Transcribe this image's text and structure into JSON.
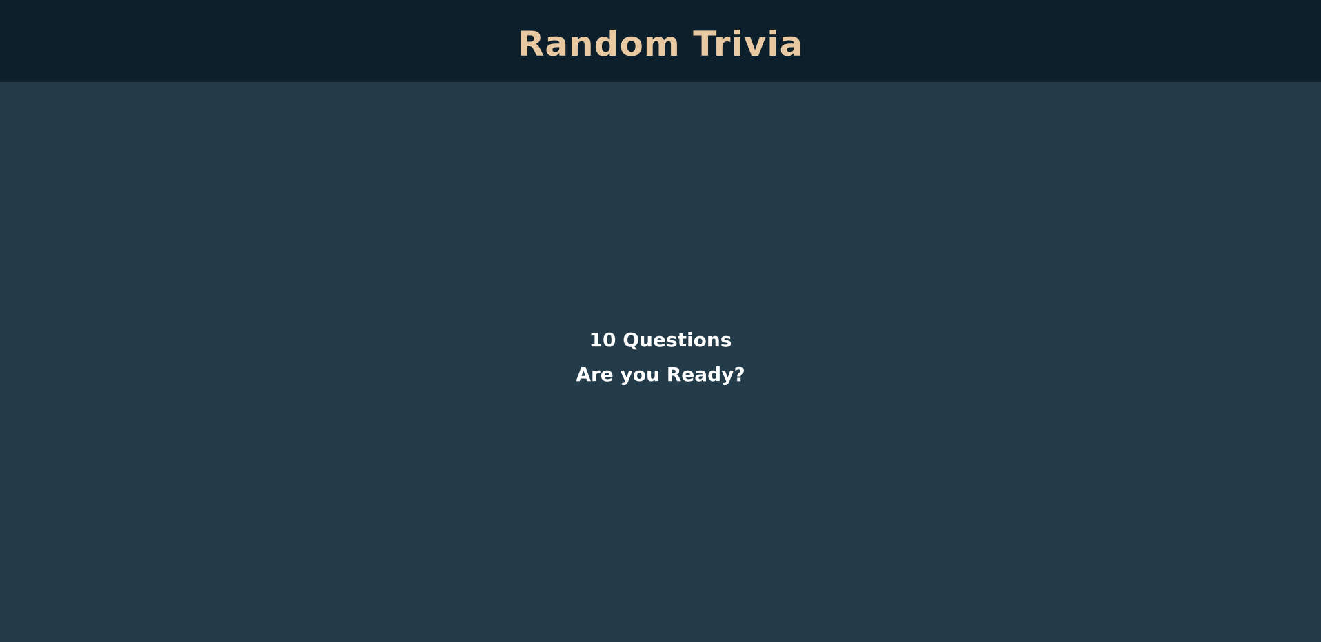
{
  "header": {
    "title": "Random Trivia"
  },
  "intro": {
    "question_count": "10 Questions",
    "prompt": "Are you Ready?"
  },
  "colors": {
    "header_bg": "#0c1f2b",
    "page_bg": "#243c4a",
    "title": "#e8c9a2",
    "text": "#ffffff"
  }
}
